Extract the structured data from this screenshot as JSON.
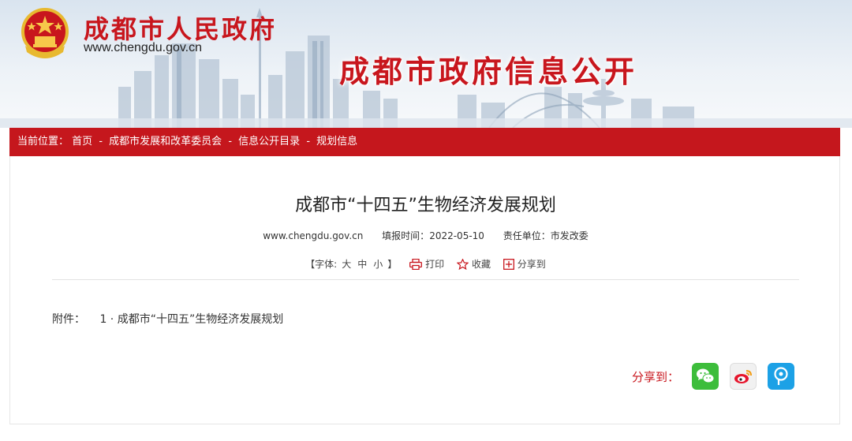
{
  "header": {
    "site_title": "成都市人民政府",
    "site_url": "www.chengdu.gov.cn",
    "portal_title": "成都市政府信息公开"
  },
  "breadcrumb": {
    "prefix": "当前位置：",
    "items": [
      {
        "label": "首页"
      },
      {
        "label": "成都市发展和改革委员会"
      },
      {
        "label": "信息公开目录"
      },
      {
        "label": "规划信息"
      }
    ],
    "separator": "-"
  },
  "article": {
    "title": "成都市“十四五”生物经济发展规划",
    "source": "www.chengdu.gov.cn",
    "date_label": "填报时间：",
    "date": "2022-05-10",
    "unit_label": "责任单位：",
    "unit": "市发改委"
  },
  "tools": {
    "font_open": "【字体:",
    "font_large": "大",
    "font_medium": "中",
    "font_small": "小",
    "font_close": "】",
    "print": "打印",
    "favorite": "收藏",
    "share": "分享到"
  },
  "attachments": {
    "label": "附件：",
    "items": [
      {
        "label": "1 · 成都市“十四五”生物经济发展规划"
      }
    ]
  },
  "share_bar": {
    "label": "分享到：",
    "buttons": [
      {
        "icon": "wechat-icon",
        "color": "#3dbd3b"
      },
      {
        "icon": "weibo-icon",
        "color": "#e6162d"
      },
      {
        "icon": "qzone-icon",
        "color": "#1ca1e6"
      }
    ]
  },
  "colors": {
    "brand_red": "#c5171d",
    "text": "#222222"
  }
}
